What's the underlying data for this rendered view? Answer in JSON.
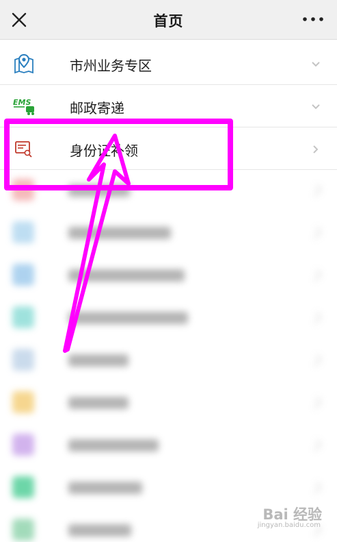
{
  "nav": {
    "title": "首页",
    "close_icon": "close-icon",
    "more_icon": "more-dots-icon"
  },
  "rows": [
    {
      "label": "市州业务专区",
      "icon": "map-pin-icon",
      "chevron": "chevron-down-icon"
    },
    {
      "label": "邮政寄递",
      "icon": "ems-truck-icon",
      "icon_text": "EMS",
      "chevron": "chevron-down-icon"
    },
    {
      "label": "身份证补领",
      "icon": "id-card-search-icon",
      "chevron": "chevron-right-icon"
    }
  ],
  "blurred_rows": [
    {
      "color": "#f2a3a3"
    },
    {
      "color": "#a9d3ee"
    },
    {
      "color": "#93c4ea"
    },
    {
      "color": "#7fd9d2"
    },
    {
      "color": "#b9cfe6"
    },
    {
      "color": "#f3c96a"
    },
    {
      "color": "#c39ae8"
    },
    {
      "color": "#3dc98c"
    },
    {
      "color": "#84cfa4"
    }
  ],
  "annotation": {
    "highlight_color": "#ff00ff",
    "target": "身份证补领"
  },
  "watermark": {
    "main": "Bai 经验",
    "sub": "jingyan.baidu.com"
  },
  "colors": {
    "navbar_bg": "#f0f0f0",
    "ems_green": "#2aa338",
    "pin_blue": "#2a7fbf",
    "id_red": "#c0392b",
    "accent_magenta": "#ff00ff"
  }
}
